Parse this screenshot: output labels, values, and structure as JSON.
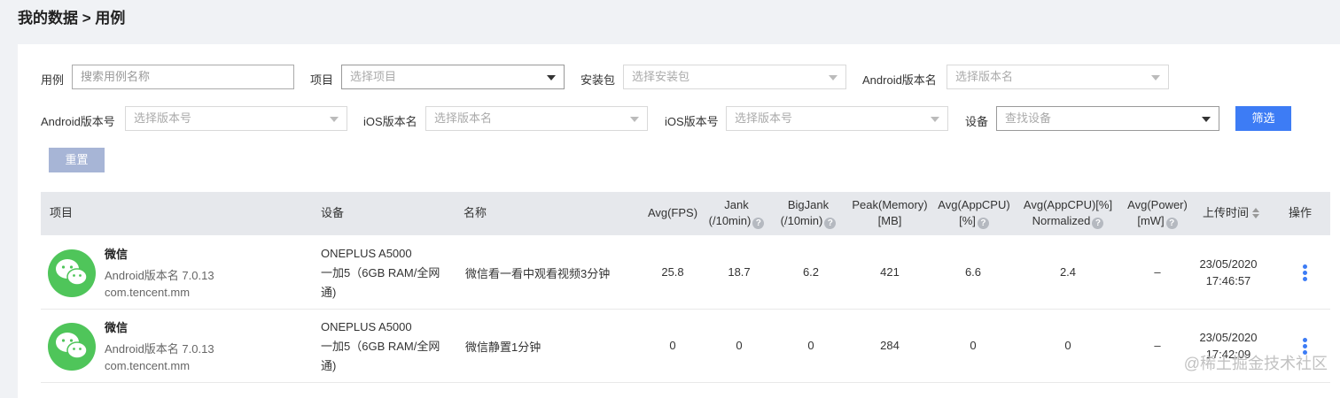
{
  "breadcrumb": "我的数据 > 用例",
  "filters": {
    "case_label": "用例",
    "case_placeholder": "搜索用例名称",
    "project_label": "项目",
    "project_placeholder": "选择项目",
    "package_label": "安装包",
    "package_placeholder": "选择安装包",
    "android_name_label": "Android版本名",
    "android_name_placeholder": "选择版本名",
    "android_code_label": "Android版本号",
    "android_code_placeholder": "选择版本号",
    "ios_name_label": "iOS版本名",
    "ios_name_placeholder": "选择版本名",
    "ios_code_label": "iOS版本号",
    "ios_code_placeholder": "选择版本号",
    "device_label": "设备",
    "device_placeholder": "查找设备",
    "filter_button": "筛选",
    "reset_button": "重置"
  },
  "table": {
    "headers": {
      "project": "项目",
      "device": "设备",
      "name": "名称",
      "fps": "Avg(FPS)",
      "jank_1": "Jank",
      "jank_2": "(/10min)",
      "bigjank_1": "BigJank",
      "bigjank_2": "(/10min)",
      "mem_1": "Peak(Memory)",
      "mem_2": "[MB]",
      "cpu_1": "Avg(AppCPU)",
      "cpu_2": "[%]",
      "cpun_1": "Avg(AppCPU)[%]",
      "cpun_2": "Normalized",
      "power_1": "Avg(Power)",
      "power_2": "[mW]",
      "upload": "上传时间",
      "ops": "操作"
    },
    "rows": [
      {
        "app": "微信",
        "version": "Android版本名 7.0.13",
        "package": "com.tencent.mm",
        "device_1": "ONEPLUS A5000",
        "device_2": "一加5（6GB RAM/全网",
        "device_3": "通)",
        "name": "微信看一看中观看视频3分钟",
        "fps": "25.8",
        "jank": "18.7",
        "bigjank": "6.2",
        "mem": "421",
        "cpu": "6.6",
        "cpun": "2.4",
        "power": "–",
        "date": "23/05/2020",
        "time": "17:46:57"
      },
      {
        "app": "微信",
        "version": "Android版本名 7.0.13",
        "package": "com.tencent.mm",
        "device_1": "ONEPLUS A5000",
        "device_2": "一加5（6GB RAM/全网",
        "device_3": "通)",
        "name": "微信静置1分钟",
        "fps": "0",
        "jank": "0",
        "bigjank": "0",
        "mem": "284",
        "cpu": "0",
        "cpun": "0",
        "power": "–",
        "date": "23/05/2020",
        "time": "17:42:09"
      }
    ]
  },
  "watermark": "@稀土掘金技术社区",
  "icons": {
    "help": "?",
    "wechat": "wechat-icon",
    "more": "more-vertical-icon"
  },
  "colors": {
    "primary": "#3d7cf5",
    "wechat": "#4fc55a",
    "reset": "#a7b5d6"
  }
}
